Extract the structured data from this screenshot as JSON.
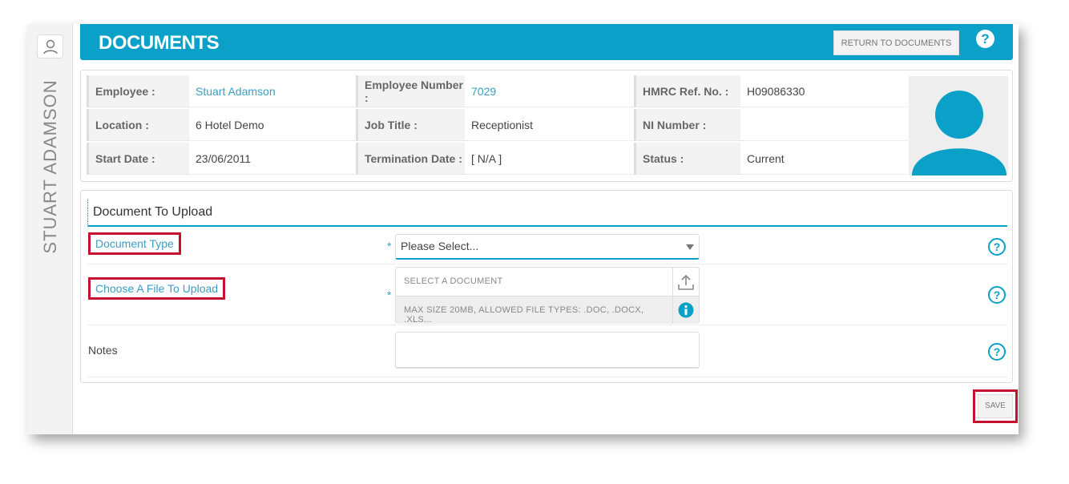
{
  "sidebar": {
    "employee_name": "STUART ADAMSON"
  },
  "header": {
    "title": "DOCUMENTS",
    "return_label": "RETURN TO DOCUMENTS",
    "help": "?"
  },
  "info": [
    {
      "label": "Employee :",
      "value": "Stuart Adamson"
    },
    {
      "label": "Employee Number :",
      "value": "7029"
    },
    {
      "label": "HMRC Ref. No. :",
      "value": "H09086330"
    },
    {
      "label": "Location :",
      "value": "6 Hotel Demo"
    },
    {
      "label": "Job Title :",
      "value": "Receptionist"
    },
    {
      "label": "NI Number :",
      "value": ""
    },
    {
      "label": "Start Date :",
      "value": "23/06/2011"
    },
    {
      "label": "Termination Date :",
      "value": "[ N/A ]"
    },
    {
      "label": "Status :",
      "value": "Current"
    }
  ],
  "form": {
    "section_title": "Document To Upload",
    "document_type_label": "Document Type",
    "document_type_value": "Please Select...",
    "file_label": "Choose A File To Upload",
    "file_placeholder": "SELECT A DOCUMENT",
    "file_hint": "MAX SIZE 20MB, ALLOWED FILE TYPES: .DOC, .DOCX, .XLS...",
    "notes_label": "Notes",
    "notes_value": "",
    "required_mark": "*",
    "help": "?"
  },
  "save_label": "SAVE",
  "colors": {
    "accent": "#0aa0c8",
    "highlight": "#c4112f"
  }
}
